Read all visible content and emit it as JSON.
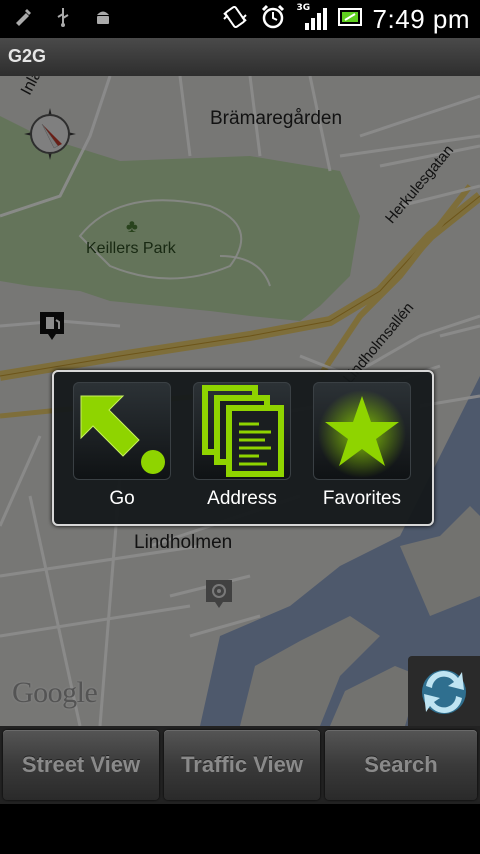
{
  "status_bar": {
    "time": "7:49 pm",
    "network": "3G",
    "icons": [
      "usb-debug-icon",
      "usb-icon",
      "android-icon",
      "vibrate-icon",
      "alarm-icon",
      "signal-icon",
      "battery-icon"
    ]
  },
  "app": {
    "title": "G2G"
  },
  "map": {
    "labels": {
      "bramaregarden": "Brämaregården",
      "keillers_park": "Keillers Park",
      "herkulesgatan": "Herkulesgatan",
      "lindholmsallen": "Lindholmsallén",
      "lindholmen": "Lindholmen",
      "inland": "Inlan"
    },
    "attribution": "Google"
  },
  "dialog": {
    "items": [
      {
        "label": "Go",
        "icon": "go-arrow-icon"
      },
      {
        "label": "Address",
        "icon": "address-documents-icon"
      },
      {
        "label": "Favorites",
        "icon": "favorites-star-icon"
      }
    ]
  },
  "toolbar": {
    "street_view": "Street View",
    "traffic_view": "Traffic View",
    "search": "Search"
  },
  "colors": {
    "accent_green": "#8fd400",
    "dialog_border": "#d8d8d8",
    "button_text": "#8a8a8a"
  }
}
